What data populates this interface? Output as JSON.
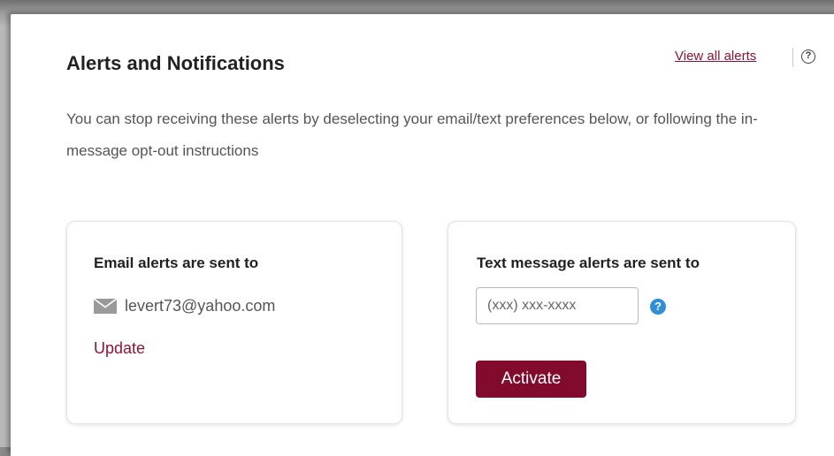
{
  "header": {
    "title": "Alerts and Notifications",
    "view_all_label": "View all alerts",
    "help_glyph": "?"
  },
  "description": "You can stop receiving these alerts by deselecting your email/text preferences below, or following the in-message opt-out instructions",
  "email_card": {
    "heading": "Email alerts are sent to",
    "email": "levert73@yahoo.com",
    "icon": "envelope-icon",
    "update_label": "Update"
  },
  "text_card": {
    "heading": "Text message alerts are sent to",
    "phone_value": "",
    "phone_placeholder": "(xxx) xxx-xxxx",
    "help_glyph": "?",
    "activate_label": "Activate"
  },
  "colors": {
    "accent": "#8a1538",
    "button": "#820a2c",
    "help_blue": "#2e8fd6"
  }
}
